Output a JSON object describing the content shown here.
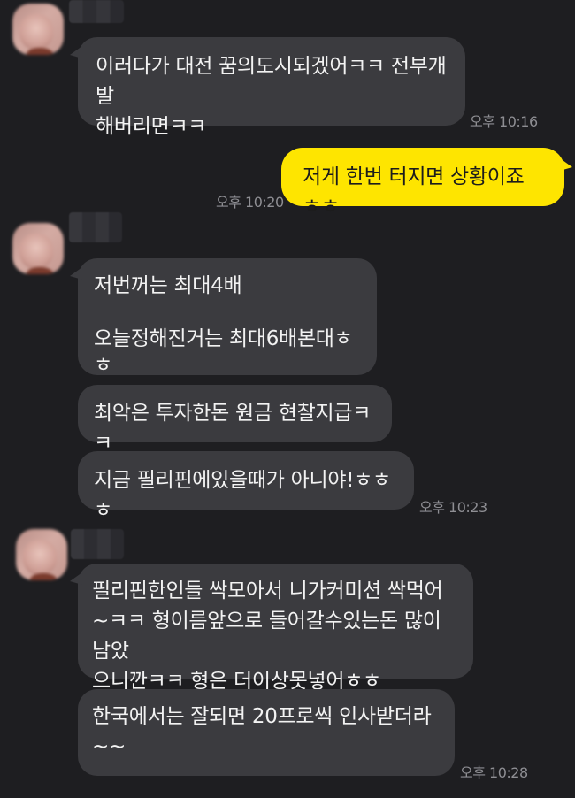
{
  "chat": {
    "messages": [
      {
        "sender": "other",
        "text": "이러다가 대전 꿈의도시되겠어ㅋㅋ 전부개발\n해버리면ㅋㅋ",
        "time": "오후 10:16"
      },
      {
        "sender": "me",
        "text": "저게 한번 터지면 상황이죠 ㅎㅎ",
        "time": "오후 10:20"
      },
      {
        "sender": "other",
        "text": "저번꺼는 최대4배\n\n오늘정해진거는 최대6배본대ㅎㅎ"
      },
      {
        "sender": "other",
        "text": "최악은 투자한돈 원금 현찰지급ㅋㅋ"
      },
      {
        "sender": "other",
        "text": "지금 필리핀에있을때가 아니야!ㅎㅎㅎ",
        "time": "오후 10:23"
      },
      {
        "sender": "other",
        "text": "필리핀한인들 싹모아서 니가커미션 싹먹어\n~ㅋㅋ 형이름앞으로 들어갈수있는돈 많이남았\n으니깐ㅋㅋ 형은 더이상못넣어ㅎㅎ"
      },
      {
        "sender": "other",
        "text": "한국에서는 잘되면 20프로씩 인사받더라\n~~",
        "time": "오후 10:28"
      }
    ]
  },
  "colors": {
    "background": "#1e1e21",
    "bubble_other": "#3b3b3f",
    "bubble_mine": "#fee500",
    "timestamp": "#8e8e93"
  }
}
